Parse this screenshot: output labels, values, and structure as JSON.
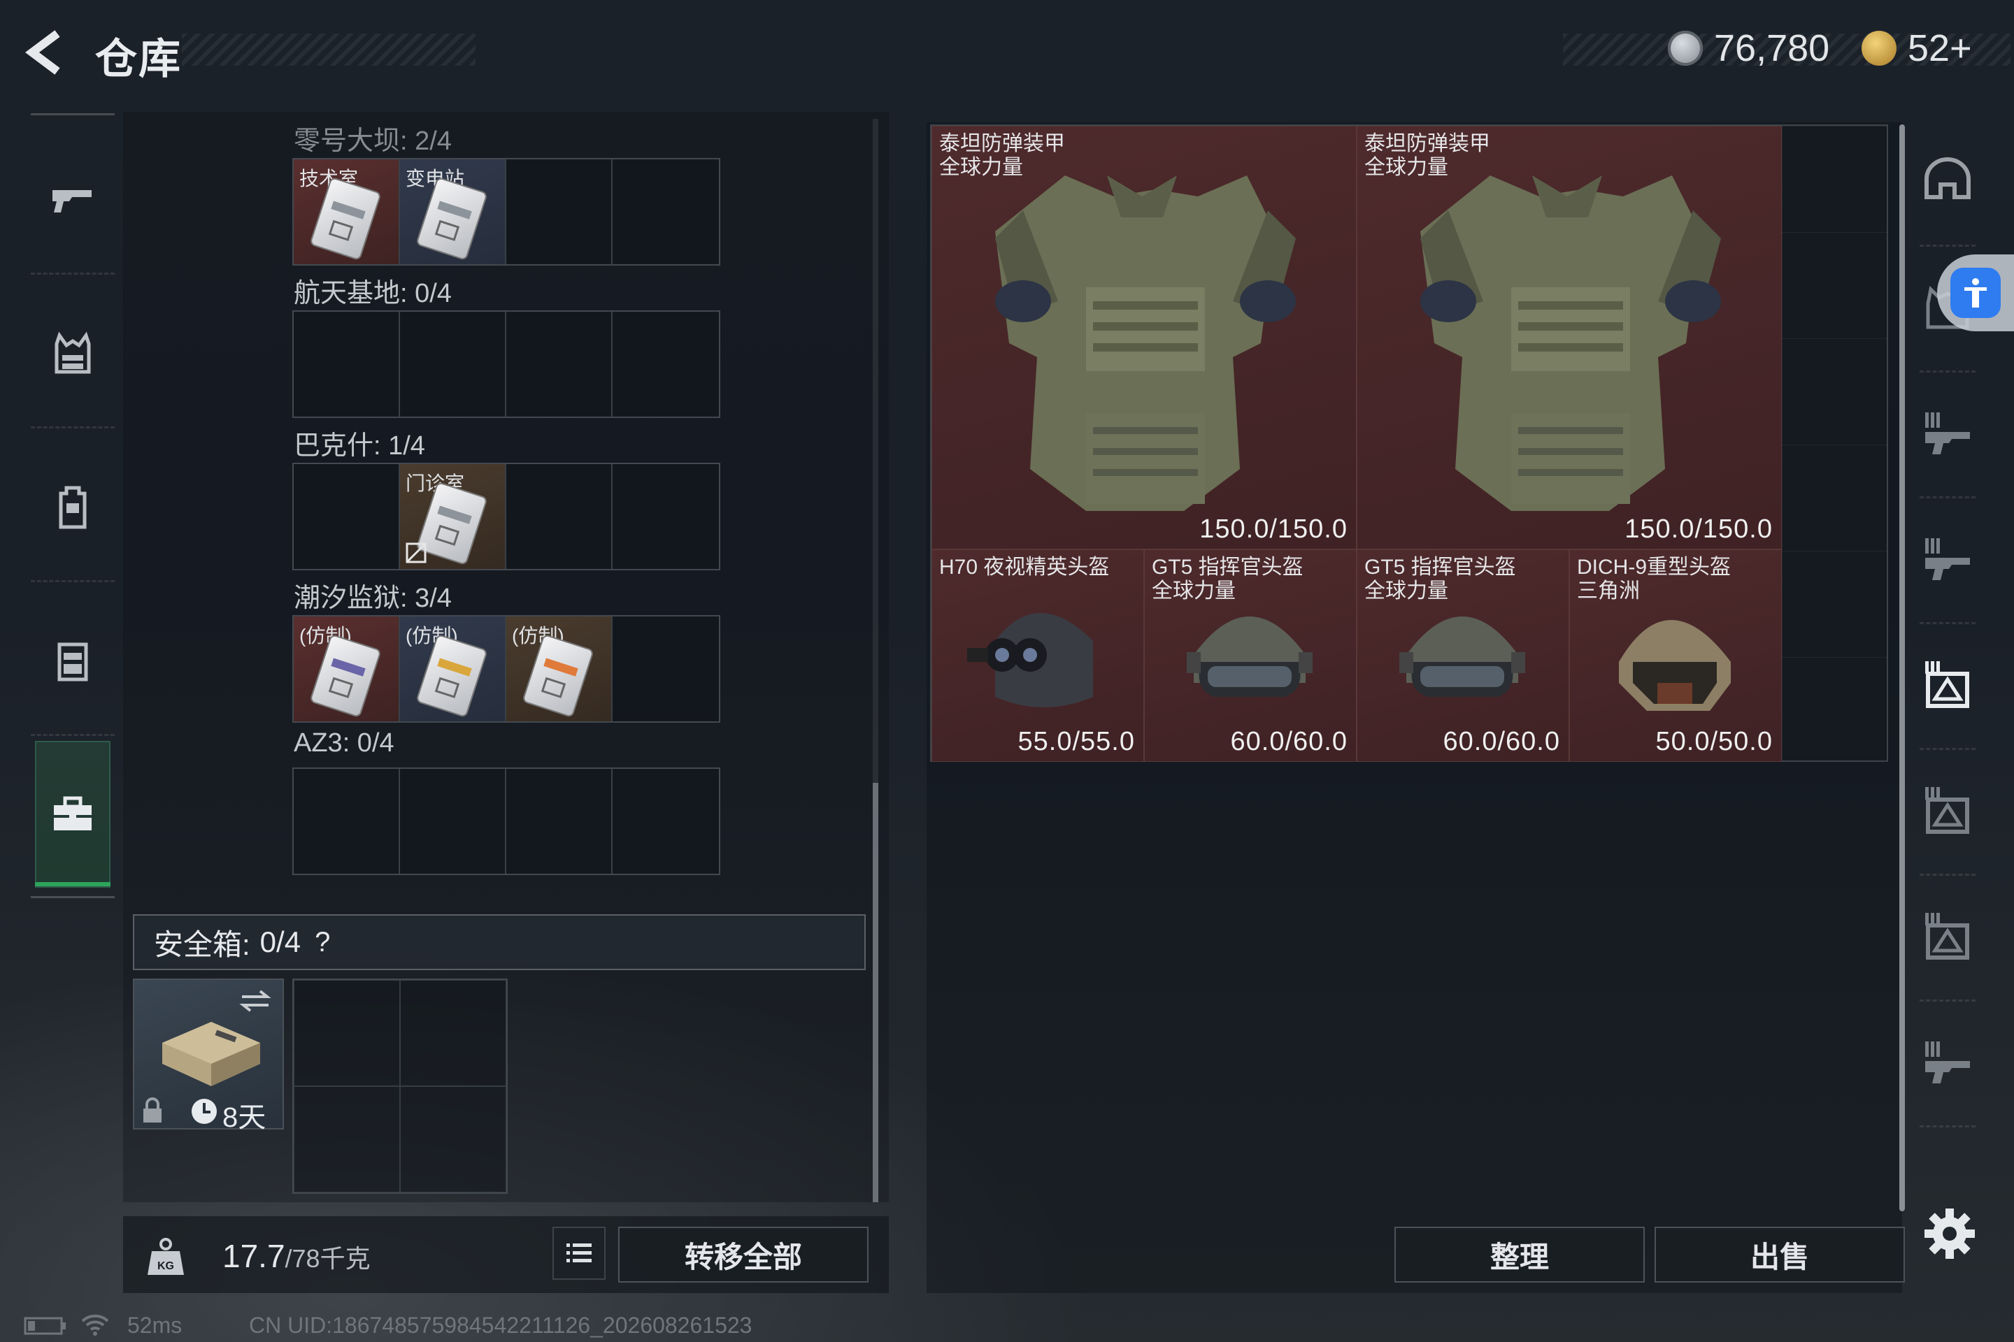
{
  "header": {
    "title": "仓库",
    "currency_1": "76,780",
    "currency_2": "52+"
  },
  "sidebar": {
    "items": [
      "weapon",
      "armor-vest",
      "backpack",
      "chest-rig",
      "toolbox"
    ]
  },
  "collections": [
    {
      "title": "零号大坝: 2/4",
      "cells": [
        {
          "label": "技术室",
          "color": "red"
        },
        {
          "label": "变电站",
          "color": "blue"
        },
        {
          "label": "",
          "color": ""
        },
        {
          "label": "",
          "color": ""
        }
      ]
    },
    {
      "title": "航天基地: 0/4",
      "cells": [
        {
          "label": "",
          "color": ""
        },
        {
          "label": "",
          "color": ""
        },
        {
          "label": "",
          "color": ""
        },
        {
          "label": "",
          "color": ""
        }
      ]
    },
    {
      "title": "巴克什: 1/4",
      "cells": [
        {
          "label": "",
          "color": ""
        },
        {
          "label": "门诊室",
          "color": "gold"
        },
        {
          "label": "",
          "color": ""
        },
        {
          "label": "",
          "color": ""
        }
      ]
    },
    {
      "title": "潮汐监狱: 3/4",
      "cells": [
        {
          "label": "(仿制)",
          "color": "red"
        },
        {
          "label": "(仿制)",
          "color": "blue"
        },
        {
          "label": "(仿制)",
          "color": "gold"
        },
        {
          "label": "",
          "color": ""
        }
      ]
    },
    {
      "title": "AZ3: 0/4",
      "cells": [
        {
          "label": "",
          "color": ""
        },
        {
          "label": "",
          "color": ""
        },
        {
          "label": "",
          "color": ""
        },
        {
          "label": "",
          "color": ""
        }
      ]
    }
  ],
  "safe_box": {
    "title": "安全箱:",
    "count": "0/4",
    "help": "?",
    "days": "8天"
  },
  "footer": {
    "weight": "17.7",
    "weight_max": "/78千克",
    "transfer_all": "转移全部",
    "organize": "整理",
    "sell": "出售"
  },
  "items": [
    {
      "name": "泰坦防弹装甲",
      "sub": "全球力量",
      "durability": "150.0/150.0"
    },
    {
      "name": "泰坦防弹装甲",
      "sub": "全球力量",
      "durability": "150.0/150.0"
    },
    {
      "name": "H70 夜视精英头盔",
      "sub": "",
      "durability": "55.0/55.0"
    },
    {
      "name": "GT5 指挥官头盔",
      "sub": "全球力量",
      "durability": "60.0/60.0"
    },
    {
      "name": "GT5 指挥官头盔",
      "sub": "全球力量",
      "durability": "60.0/60.0"
    },
    {
      "name": "DICH-9重型头盔",
      "sub": "三角洲",
      "durability": "50.0/50.0"
    }
  ],
  "status": {
    "ping": "52ms",
    "uid": "CN UID:186748575984542211126_202608261523"
  },
  "colors": {
    "item_red": "#4e2a2c",
    "panel": "#1a2028",
    "accent_green": "#2ea35a",
    "accessibility_blue": "#2f7cf0"
  }
}
